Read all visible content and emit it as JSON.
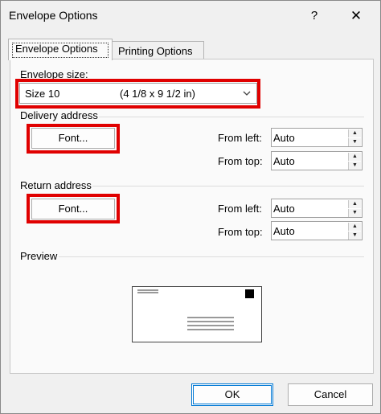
{
  "window": {
    "title": "Envelope Options",
    "help": "?",
    "close": "✕"
  },
  "tabs": [
    {
      "label": "Envelope Options",
      "active": true
    },
    {
      "label": "Printing Options",
      "active": false
    }
  ],
  "envelope_size": {
    "label": "Envelope size:",
    "value": "Size 10",
    "dimensions": "(4 1/8 x 9 1/2 in)"
  },
  "delivery_address": {
    "label": "Delivery address",
    "font_button": "Font...",
    "from_left_label": "From left:",
    "from_left_value": "Auto",
    "from_top_label": "From top:",
    "from_top_value": "Auto"
  },
  "return_address": {
    "label": "Return address",
    "font_button": "Font...",
    "from_left_label": "From left:",
    "from_left_value": "Auto",
    "from_top_label": "From top:",
    "from_top_value": "Auto"
  },
  "preview": {
    "label": "Preview"
  },
  "buttons": {
    "ok": "OK",
    "cancel": "Cancel"
  },
  "colors": {
    "highlight": "#e00000",
    "accent": "#0078d4"
  }
}
